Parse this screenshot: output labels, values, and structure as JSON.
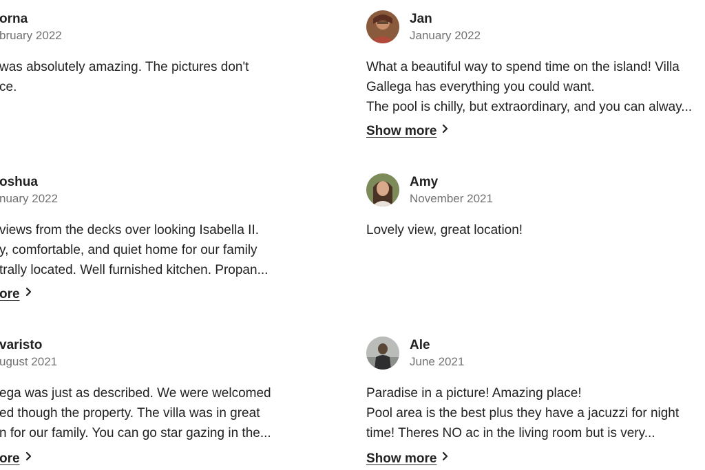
{
  "reviews": [
    {
      "name": "orna",
      "date": "bruary 2022",
      "lines": [
        "was absolutely amazing. The pictures don't",
        "ce."
      ],
      "show_more": ""
    },
    {
      "name": "Jan",
      "date": "January 2022",
      "lines": [
        "What a beautiful way to spend time on the island! Villa",
        "Gallega has everything you could want.",
        "The pool is chilly, but extraordinary, and you can alway..."
      ],
      "show_more": "Show more"
    },
    {
      "name": "oshua",
      "date": "nuary 2022",
      "lines": [
        "views from the decks over looking Isabella II.",
        "y, comfortable, and quiet home for our family",
        "trally located. Well furnished kitchen. Propan..."
      ],
      "show_more": "ore"
    },
    {
      "name": "Amy",
      "date": "November 2021",
      "lines": [
        "Lovely view, great location!"
      ],
      "show_more": ""
    },
    {
      "name": "varisto",
      "date": "ugust 2021",
      "lines": [
        "ega was just as described. We were welcomed",
        "ed though the property. The villa was in great",
        "n for our family. You can go star gazing in the..."
      ],
      "show_more": "ore"
    },
    {
      "name": "Ale",
      "date": "June 2021",
      "lines": [
        "Paradise in a picture! Amazing place!",
        "Pool area is the best plus they have a jacuzzi for night",
        "time! Theres NO ac in the living room but is very..."
      ],
      "show_more": "Show more"
    }
  ],
  "icons": {
    "chevron": "chevron-right-icon",
    "avatar": "avatar"
  },
  "colors": {
    "text": "#222222",
    "secondary": "#717171",
    "background": "#ffffff"
  }
}
